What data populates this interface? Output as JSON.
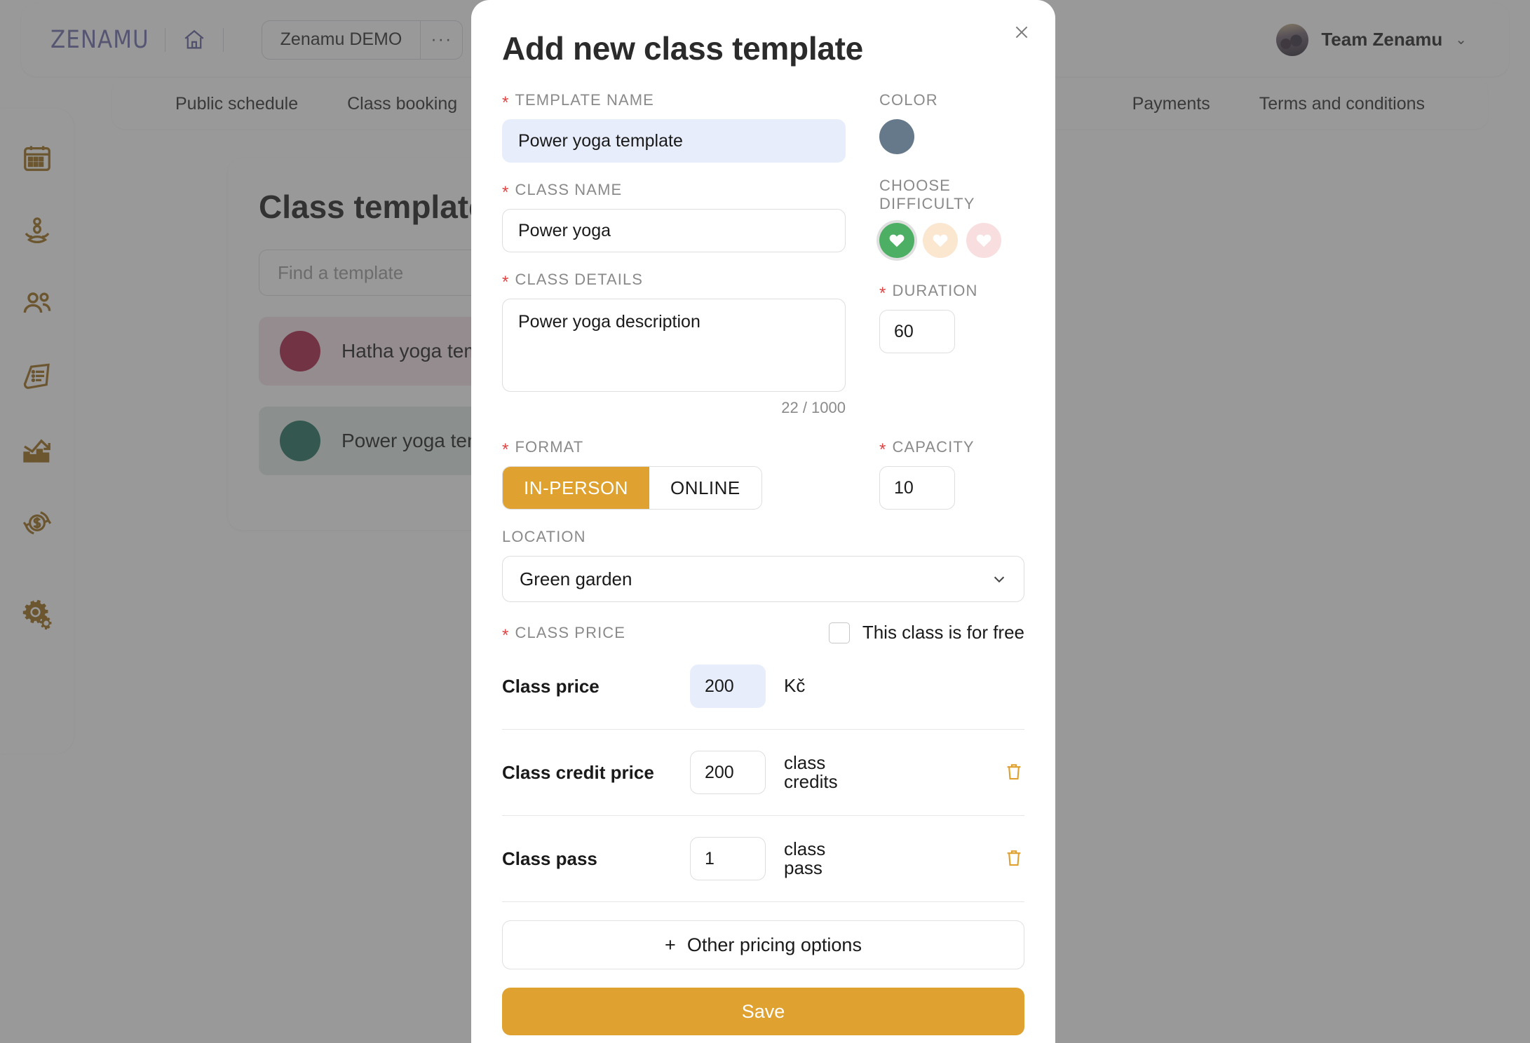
{
  "header": {
    "brand": "ZENAMU",
    "home_icon": "home-icon",
    "studio_name": "Zenamu DEMO",
    "studio_more": "···",
    "user_name": "Team Zenamu",
    "user_chevron": "⌄"
  },
  "subnav": {
    "tabs": [
      {
        "label": "Public schedule"
      },
      {
        "label": "Class booking"
      },
      {
        "label": "Payments"
      },
      {
        "label": "Terms and conditions"
      }
    ]
  },
  "sidebar": {
    "items": [
      {
        "icon": "calendar-icon",
        "name": "schedule"
      },
      {
        "icon": "yoga-person-icon",
        "name": "classes"
      },
      {
        "icon": "people-icon",
        "name": "students"
      },
      {
        "icon": "invoice-icon",
        "name": "invoices"
      },
      {
        "icon": "bar-chart-icon",
        "name": "statistics"
      },
      {
        "icon": "dollar-refresh-icon",
        "name": "finance"
      },
      {
        "icon": "gears-icon",
        "name": "settings"
      }
    ],
    "active": "settings",
    "accent_color": "#9a6a17"
  },
  "content": {
    "title": "Class templates",
    "search_placeholder": "Find a template",
    "templates": [
      {
        "label": "Hatha yoga template",
        "color": "#a81f45"
      },
      {
        "label": "Power yoga template",
        "color": "#1f6e5c"
      }
    ]
  },
  "modal": {
    "title": "Add new class template",
    "close_icon": "close-icon",
    "template_name": {
      "label": "TEMPLATE NAME",
      "required": true,
      "value": "Power yoga template",
      "focused": true
    },
    "class_name": {
      "label": "CLASS NAME",
      "required": true,
      "value": "Power yoga"
    },
    "class_details": {
      "label": "CLASS DETAILS",
      "required": true,
      "value": "Power yoga description",
      "counter": "22 / 1000"
    },
    "color": {
      "label": "COLOR",
      "value": "#65798a"
    },
    "difficulty": {
      "label": "CHOOSE DIFFICULTY",
      "options": [
        {
          "name": "easy",
          "color": "#4caf63",
          "selected": true
        },
        {
          "name": "medium",
          "color": "#fbe6d0",
          "selected": false
        },
        {
          "name": "hard",
          "color": "#f8dede",
          "selected": false
        }
      ]
    },
    "duration": {
      "label": "DURATION",
      "required": true,
      "value": "60"
    },
    "format": {
      "label": "FORMAT",
      "required": true,
      "options": [
        {
          "label": "IN-PERSON",
          "active": true
        },
        {
          "label": "ONLINE",
          "active": false
        }
      ]
    },
    "capacity": {
      "label": "CAPACITY",
      "required": true,
      "value": "10"
    },
    "location": {
      "label": "LOCATION",
      "value": "Green garden",
      "chevron": "⌄"
    },
    "class_price": {
      "label": "CLASS PRICE",
      "required": true,
      "free_checkbox_label": "This class is for free",
      "free_checked": false
    },
    "price_rows": [
      {
        "name": "Class price",
        "value": "200",
        "unit": "Kč",
        "deletable": false,
        "focused": true
      },
      {
        "name": "Class credit price",
        "value": "200",
        "unit": "class credits",
        "deletable": true,
        "focused": false
      },
      {
        "name": "Class pass",
        "value": "1",
        "unit": "class pass",
        "deletable": true,
        "focused": false
      }
    ],
    "other_pricing_label": "Other pricing options",
    "other_pricing_plus": "+",
    "save_label": "Save",
    "accent_color": "#dfa12f"
  }
}
